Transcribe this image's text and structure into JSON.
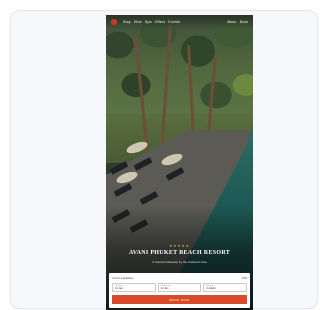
{
  "nav": {
    "logo_icon": "logo-icon",
    "items": [
      "Stay",
      "Dine",
      "Spa",
      "Offers",
      "Events"
    ],
    "right_items": [
      "Menu",
      "Book"
    ]
  },
  "hero": {
    "stars": "★★★★★",
    "title": "AVANI PHUKET BEACH RESORT",
    "subtitle": "A tropical hideaway by the Andaman Sea"
  },
  "booking": {
    "heading": "Check availability",
    "currency": "THB",
    "fields": [
      {
        "label": "Check in",
        "value": "12 Jan"
      },
      {
        "label": "Check out",
        "value": "14 Jan"
      },
      {
        "label": "Guests",
        "value": "2 Adults"
      }
    ],
    "cta": "BOOK NOW"
  },
  "colors": {
    "accent": "#d94a28",
    "logo": "#d8332b",
    "star": "#e2b94b"
  }
}
